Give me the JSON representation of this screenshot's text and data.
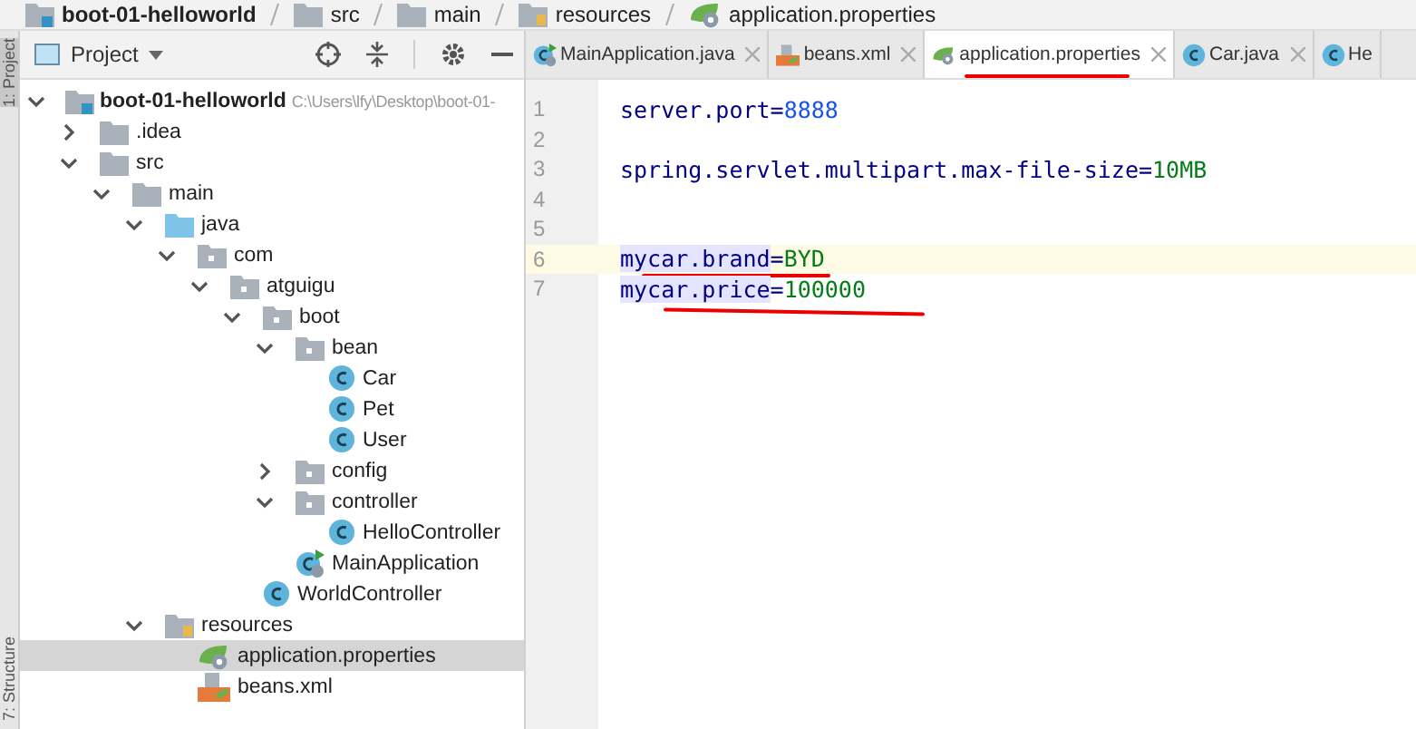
{
  "breadcrumb": [
    {
      "label": "boot-01-helloworld",
      "kind": "module"
    },
    {
      "label": "src",
      "kind": "folder"
    },
    {
      "label": "main",
      "kind": "folder"
    },
    {
      "label": "resources",
      "kind": "resources"
    },
    {
      "label": "application.properties",
      "kind": "properties"
    }
  ],
  "side_strip": [
    "1: Project",
    "7: Structure"
  ],
  "project_panel": {
    "title": "Project",
    "tree": [
      {
        "label": "boot-01-helloworld",
        "path": "C:\\Users\\lfy\\Desktop\\boot-01-",
        "kind": "module",
        "expanded": true,
        "selected": false,
        "children": [
          {
            "label": ".idea",
            "kind": "folder",
            "expanded": false,
            "selected": false
          },
          {
            "label": "src",
            "kind": "folder",
            "expanded": true,
            "selected": false,
            "children": [
              {
                "label": "main",
                "kind": "folder",
                "expanded": true,
                "selected": false,
                "children": [
                  {
                    "label": "java",
                    "kind": "source",
                    "expanded": true,
                    "selected": false,
                    "children": [
                      {
                        "label": "com",
                        "kind": "package",
                        "expanded": true,
                        "selected": false,
                        "children": [
                          {
                            "label": "atguigu",
                            "kind": "package",
                            "expanded": true,
                            "selected": false,
                            "children": [
                              {
                                "label": "boot",
                                "kind": "package",
                                "expanded": true,
                                "selected": false,
                                "children": [
                                  {
                                    "label": "bean",
                                    "kind": "package",
                                    "expanded": true,
                                    "selected": false,
                                    "children": [
                                      {
                                        "label": "Car",
                                        "kind": "class",
                                        "selected": false
                                      },
                                      {
                                        "label": "Pet",
                                        "kind": "class",
                                        "selected": false
                                      },
                                      {
                                        "label": "User",
                                        "kind": "class",
                                        "selected": false
                                      }
                                    ]
                                  },
                                  {
                                    "label": "config",
                                    "kind": "package",
                                    "expanded": false,
                                    "selected": false
                                  },
                                  {
                                    "label": "controller",
                                    "kind": "package",
                                    "expanded": true,
                                    "selected": false,
                                    "children": [
                                      {
                                        "label": "HelloController",
                                        "kind": "class",
                                        "selected": false
                                      }
                                    ]
                                  },
                                  {
                                    "label": "MainApplication",
                                    "kind": "boot",
                                    "selected": false
                                  }
                                ]
                              },
                              {
                                "label": "WorldController",
                                "kind": "class",
                                "selected": false
                              }
                            ]
                          }
                        ]
                      }
                    ]
                  },
                  {
                    "label": "resources",
                    "kind": "resources",
                    "expanded": true,
                    "selected": false,
                    "children": [
                      {
                        "label": "application.properties",
                        "kind": "properties",
                        "selected": true
                      },
                      {
                        "label": "beans.xml",
                        "kind": "xml",
                        "selected": false
                      }
                    ]
                  }
                ]
              }
            ]
          }
        ]
      }
    ]
  },
  "tabs": [
    {
      "label": "MainApplication.java",
      "kind": "boot",
      "selected": false
    },
    {
      "label": "beans.xml",
      "kind": "xml",
      "selected": false
    },
    {
      "label": "application.properties",
      "kind": "properties",
      "selected": true
    },
    {
      "label": "Car.java",
      "kind": "class",
      "selected": false
    },
    {
      "label": "He",
      "kind": "class",
      "selected": false
    }
  ],
  "editor": {
    "lines": [
      {
        "number": "1",
        "key": "server.port",
        "sep": "=",
        "value": "8888",
        "kind": "number",
        "current": false
      },
      {
        "number": "2",
        "current": false
      },
      {
        "number": "3",
        "key": "spring.servlet.multipart.max-file-size",
        "sep": "=",
        "value": "10MB",
        "kind": "string",
        "current": false
      },
      {
        "number": "4",
        "current": false
      },
      {
        "number": "5",
        "current": false
      },
      {
        "number": "6",
        "key": "mycar.brand",
        "sep": "=",
        "value": "BYD",
        "kind": "string",
        "current": true
      },
      {
        "number": "7",
        "key": "mycar.price",
        "sep": "=",
        "value": "100000",
        "kind": "string",
        "current": false
      }
    ]
  }
}
